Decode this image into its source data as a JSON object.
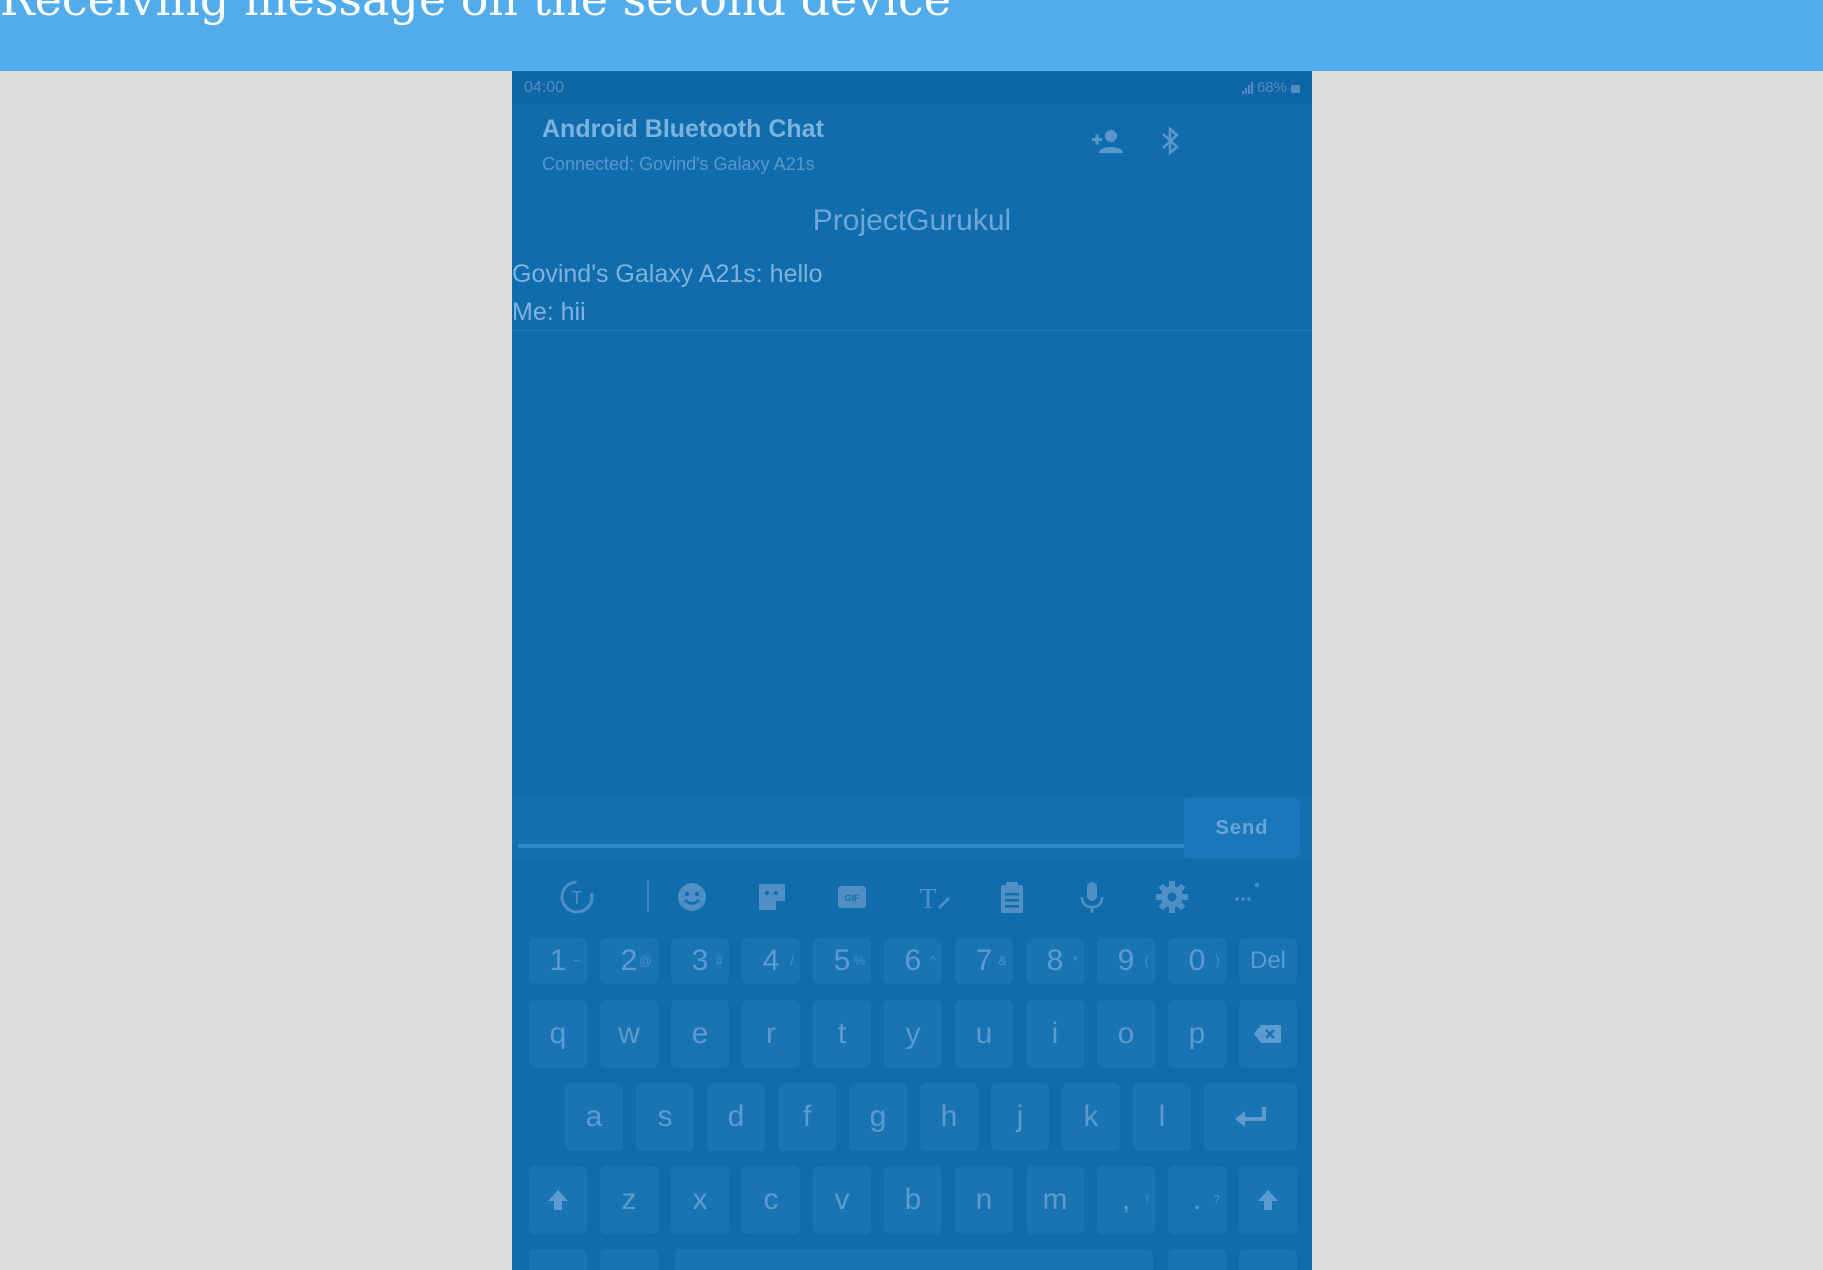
{
  "banner": {
    "title": "Receiving message on the second device"
  },
  "status_bar": {
    "time": "04:00",
    "battery": "68%"
  },
  "app_bar": {
    "title": "Android Bluetooth Chat",
    "subtitle": "Connected: Govind's Galaxy A21s",
    "icons": [
      "add-person-icon",
      "bluetooth-icon"
    ]
  },
  "brand": "ProjectGurukul",
  "messages": [
    {
      "text": "Govind's Galaxy A21s: hello"
    },
    {
      "text": "Me: hii"
    }
  ],
  "composer": {
    "placeholder": "",
    "send_label": "Send"
  },
  "keyboard_toolbar": [
    "text-translate-icon",
    "emoji-icon",
    "sticker-icon",
    "gif-icon",
    "handwriting-icon",
    "clipboard-icon",
    "mic-icon",
    "settings-icon",
    "more-icon"
  ],
  "keyboard": {
    "row1": [
      {
        "k": "1",
        "s": "~"
      },
      {
        "k": "2",
        "s": "@"
      },
      {
        "k": "3",
        "s": "#"
      },
      {
        "k": "4",
        "s": "/"
      },
      {
        "k": "5",
        "s": "%"
      },
      {
        "k": "6",
        "s": "^"
      },
      {
        "k": "7",
        "s": "&"
      },
      {
        "k": "8",
        "s": "*"
      },
      {
        "k": "9",
        "s": "("
      },
      {
        "k": "0",
        "s": ")"
      },
      {
        "k": "Del",
        "s": ""
      }
    ],
    "row2": [
      "q",
      "w",
      "e",
      "r",
      "t",
      "y",
      "u",
      "i",
      "o",
      "p"
    ],
    "row3": [
      "a",
      "s",
      "d",
      "f",
      "g",
      "h",
      "j",
      "k",
      "l"
    ],
    "row4": [
      "z",
      "x",
      "c",
      "v",
      "b",
      "n",
      "m"
    ],
    "row4_punct": [
      {
        "k": ",",
        "s": "!"
      },
      {
        "k": ".",
        "s": "?"
      }
    ]
  },
  "colors": {
    "banner": "#52abea",
    "overlay": "#106cad",
    "background": "#dcdcdc"
  }
}
